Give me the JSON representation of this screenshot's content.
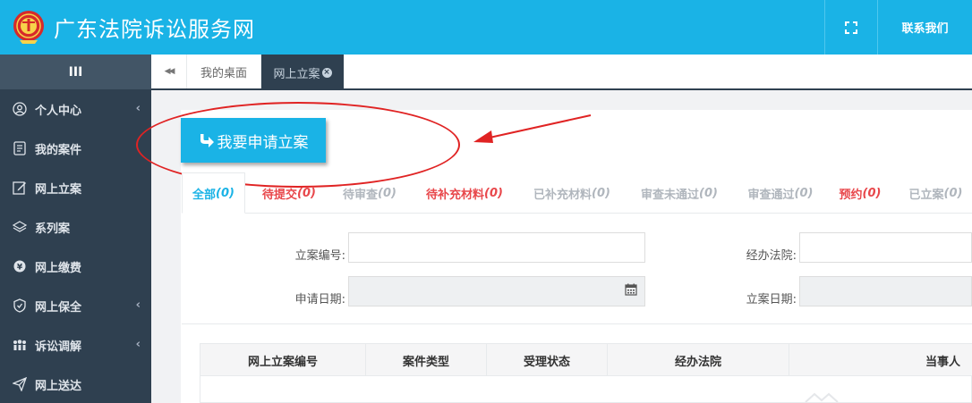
{
  "header": {
    "title": "广东法院诉讼服务网",
    "contact_label": "联系我们",
    "bg_color": "#1ab3e6"
  },
  "sidebar": {
    "toggle_label": "III",
    "items": [
      {
        "label": "个人中心",
        "icon": "user-icon",
        "has_submenu": true
      },
      {
        "label": "我的案件",
        "icon": "document-icon",
        "has_submenu": false
      },
      {
        "label": "网上立案",
        "icon": "edit-icon",
        "has_submenu": false
      },
      {
        "label": "系列案",
        "icon": "layers-icon",
        "has_submenu": false
      },
      {
        "label": "网上缴费",
        "icon": "money-icon",
        "has_submenu": false
      },
      {
        "label": "网上保全",
        "icon": "shield-icon",
        "has_submenu": true
      },
      {
        "label": "诉讼调解",
        "icon": "people-icon",
        "has_submenu": true
      },
      {
        "label": "网上送达",
        "icon": "send-icon",
        "has_submenu": false
      }
    ],
    "submenu_arrow": "‹"
  },
  "tabs": {
    "back_icon": "◀◀",
    "desktop_label": "我的桌面",
    "active_label": "网上立案",
    "close_glyph": "×"
  },
  "main": {
    "apply_button_label": "我要申请立案",
    "status_tabs": [
      {
        "label": "全部",
        "count": "(0)"
      },
      {
        "label": "待提交",
        "count": "(0)"
      },
      {
        "label": "待审查",
        "count": "(0)"
      },
      {
        "label": "待补充材料",
        "count": "(0)"
      },
      {
        "label": "已补充材料",
        "count": "(0)"
      },
      {
        "label": "审查未通过",
        "count": "(0)"
      },
      {
        "label": "审查通过",
        "count": "(0)"
      },
      {
        "label": "预约",
        "count": "(0)"
      },
      {
        "label": "已立案",
        "count": "(0)"
      }
    ],
    "form": {
      "case_number_label": "立案编号:",
      "court_label": "经办法院:",
      "apply_date_label": "申请日期:",
      "filing_date_label": "立案日期:",
      "case_number_value": "",
      "court_value": ""
    },
    "table": {
      "headers": [
        "网上立案编号",
        "案件类型",
        "受理状态",
        "经办法院",
        "当事人"
      ]
    }
  }
}
